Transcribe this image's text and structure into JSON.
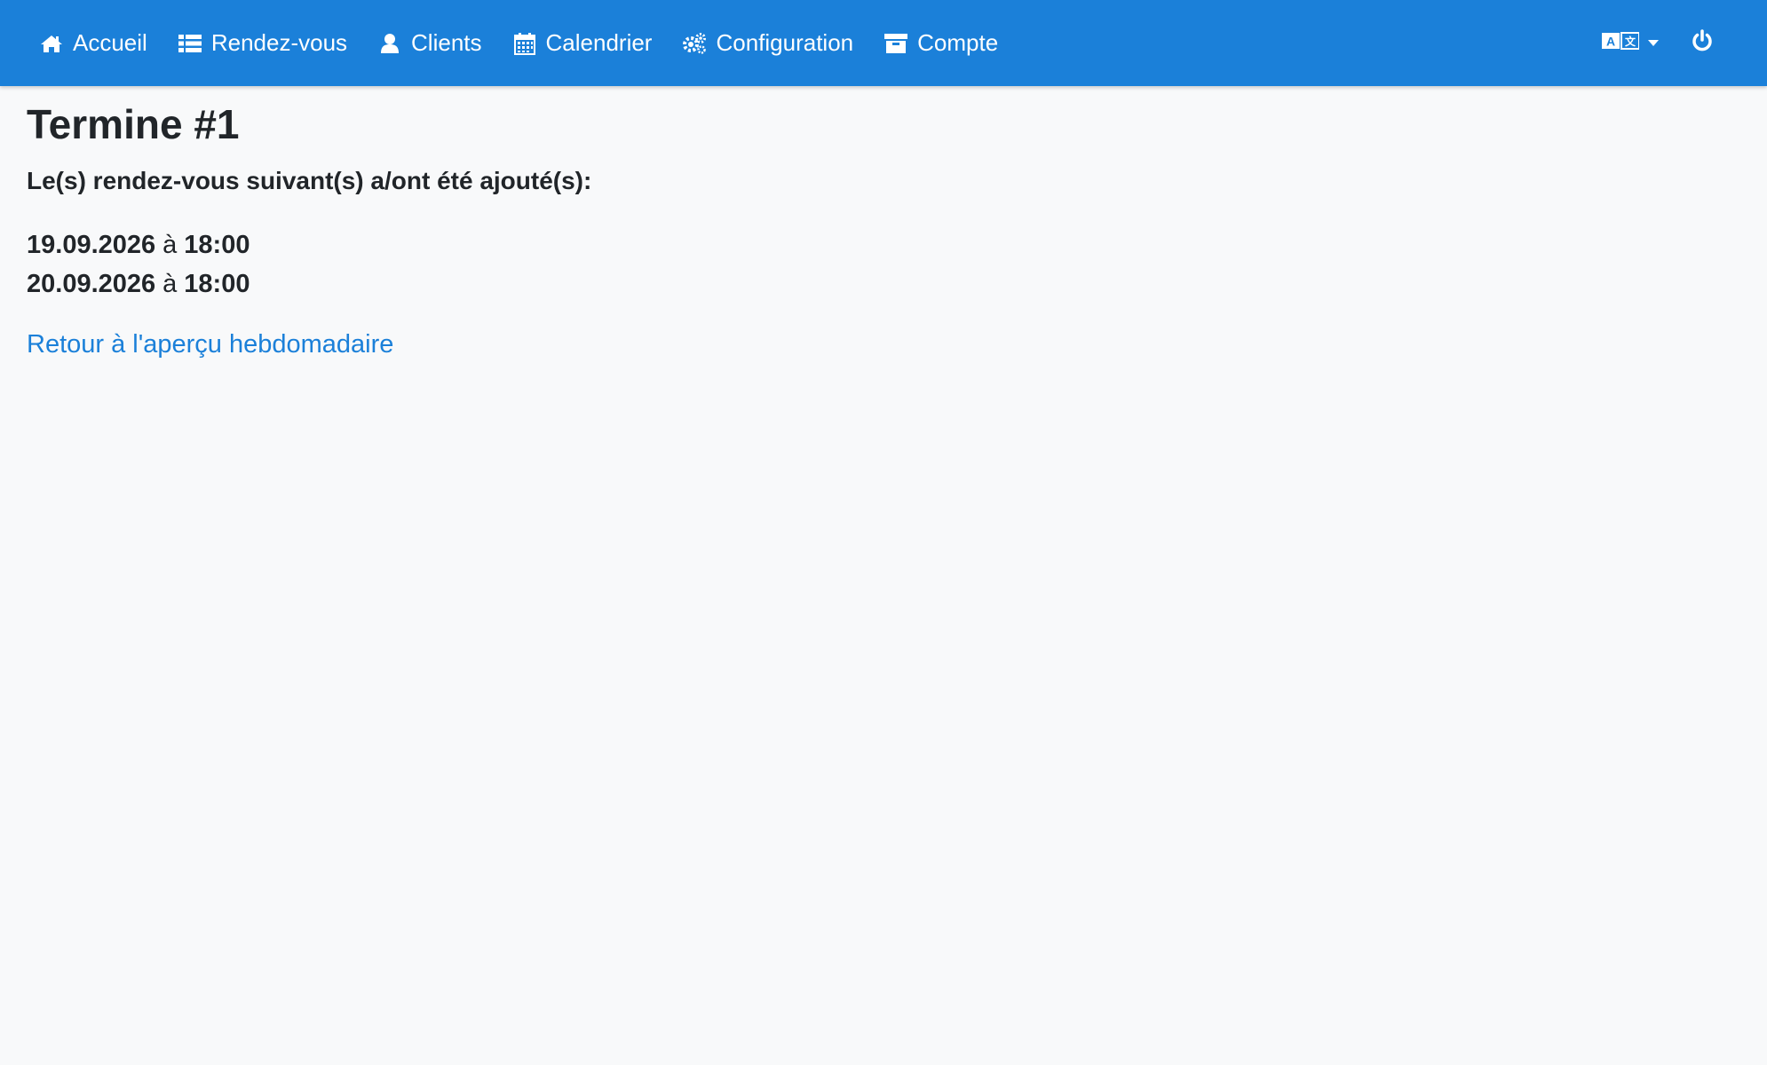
{
  "nav": {
    "items": [
      {
        "label": "Accueil",
        "icon": "home-icon"
      },
      {
        "label": "Rendez-vous",
        "icon": "list-icon"
      },
      {
        "label": "Clients",
        "icon": "user-icon"
      },
      {
        "label": "Calendrier",
        "icon": "calendar-icon"
      },
      {
        "label": "Configuration",
        "icon": "cogs-icon"
      },
      {
        "label": "Compte",
        "icon": "archive-icon"
      }
    ],
    "language_icon": "language-icon",
    "logout_icon": "power-icon"
  },
  "page": {
    "title": "Termine #1",
    "intro": "Le(s) rendez-vous suivant(s) a/ont été ajouté(s):",
    "appointments": [
      {
        "date": "19.09.2026",
        "sep": "à",
        "time": "18:00"
      },
      {
        "date": "20.09.2026",
        "sep": "à",
        "time": "18:00"
      }
    ],
    "back_link": "Retour à l'aperçu hebdomadaire"
  },
  "colors": {
    "navbar": "#1b80d9",
    "background": "#f8f9fa",
    "link": "#1b80d9"
  }
}
